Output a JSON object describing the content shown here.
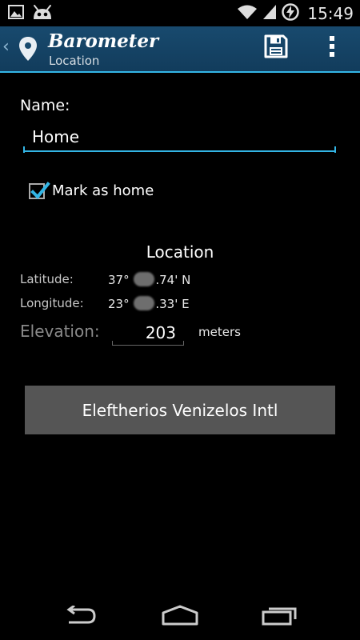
{
  "status_bar": {
    "time": "15:49",
    "left_icons": [
      "image-icon",
      "android-cyanogen-icon"
    ],
    "right_icons": [
      "wifi-icon",
      "signal-icon",
      "battery-charging-icon"
    ]
  },
  "action_bar": {
    "title": "Barometer",
    "subtitle": "Location",
    "icons": [
      "up-caret-icon",
      "location-pin-icon",
      "save-icon",
      "overflow-menu-icon"
    ]
  },
  "form": {
    "name_label": "Name:",
    "name_value": "Home",
    "mark_home_label": "Mark as home",
    "mark_home_checked": true,
    "section_title": "Location",
    "latitude_label": "Latitude:",
    "latitude_deg": "37°",
    "latitude_rest": ".74' N",
    "longitude_label": "Longitude:",
    "longitude_deg": "23°",
    "longitude_rest": ".33' E",
    "elevation_label": "Elevation:",
    "elevation_value": "203",
    "elevation_unit": "meters",
    "airport_button": "Eleftherios Venizelos Intl"
  },
  "nav_bar": {
    "icons": [
      "back-icon",
      "home-icon",
      "recents-icon"
    ]
  },
  "colors": {
    "accent": "#33b5e5",
    "action_bar": "#184a6e",
    "button": "#555555",
    "background": "#000000"
  }
}
